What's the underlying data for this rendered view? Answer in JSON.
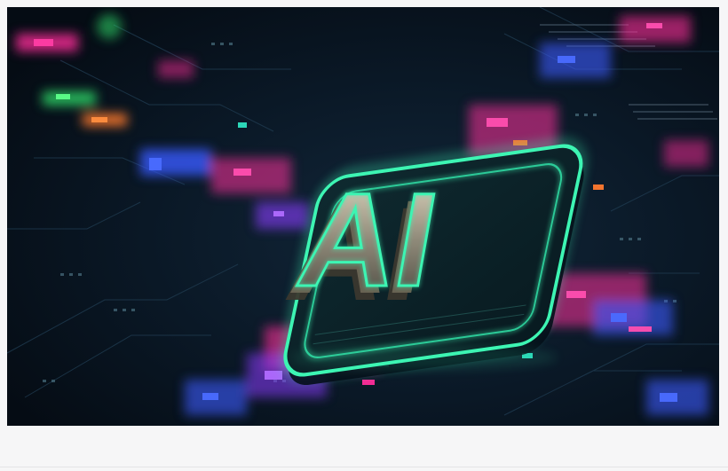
{
  "image": {
    "chip_label": "AI"
  },
  "colors": {
    "background": "#f6f6f7",
    "board": "#07121d",
    "neon_green": "#3df5b3",
    "neon_pink": "#ff2d9a",
    "neon_blue": "#3a5bff",
    "neon_orange": "#ff7a2f"
  }
}
